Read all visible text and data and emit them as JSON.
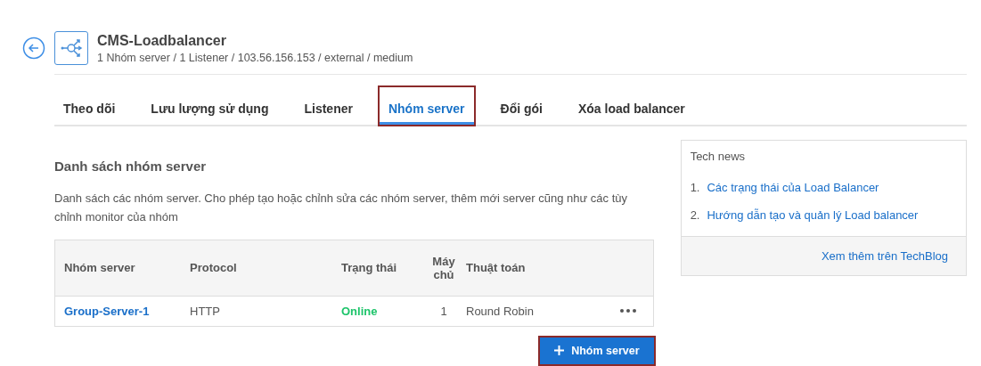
{
  "header": {
    "title": "CMS-Loadbalancer",
    "subtitle": "1 Nhóm server / 1 Listener / 103.56.156.153 / external / medium"
  },
  "tabs": [
    {
      "label": "Theo dõi",
      "selected": false,
      "outlined": false
    },
    {
      "label": "Lưu lượng sử dụng",
      "selected": false,
      "outlined": false
    },
    {
      "label": "Listener",
      "selected": false,
      "outlined": false
    },
    {
      "label": "Nhóm server",
      "selected": true,
      "outlined": true
    },
    {
      "label": "Đổi gói",
      "selected": false,
      "outlined": false
    },
    {
      "label": "Xóa load balancer",
      "selected": false,
      "outlined": false
    }
  ],
  "section": {
    "title": "Danh sách nhóm server",
    "description": "Danh sách các nhóm server. Cho phép tạo hoặc chỉnh sửa các nhóm server, thêm mới server cũng như các tùy chỉnh monitor của nhóm"
  },
  "table": {
    "columns": [
      "Nhóm server",
      "Protocol",
      "Trạng thái",
      "Máy chủ",
      "Thuật toán"
    ],
    "rows": [
      {
        "name": "Group-Server-1",
        "protocol": "HTTP",
        "status": "Online",
        "online": true,
        "servers": "1",
        "algorithm": "Round Robin"
      }
    ]
  },
  "add_button": {
    "label": "Nhóm server",
    "outlined": true
  },
  "tech_news": {
    "title": "Tech news",
    "items": [
      {
        "number": "1.",
        "label": "Các trạng thái của Load Balancer"
      },
      {
        "number": "2.",
        "label": "Hướng dẫn tạo và quản lý Load balancer"
      }
    ],
    "footer_link": "Xem thêm trên TechBlog"
  }
}
